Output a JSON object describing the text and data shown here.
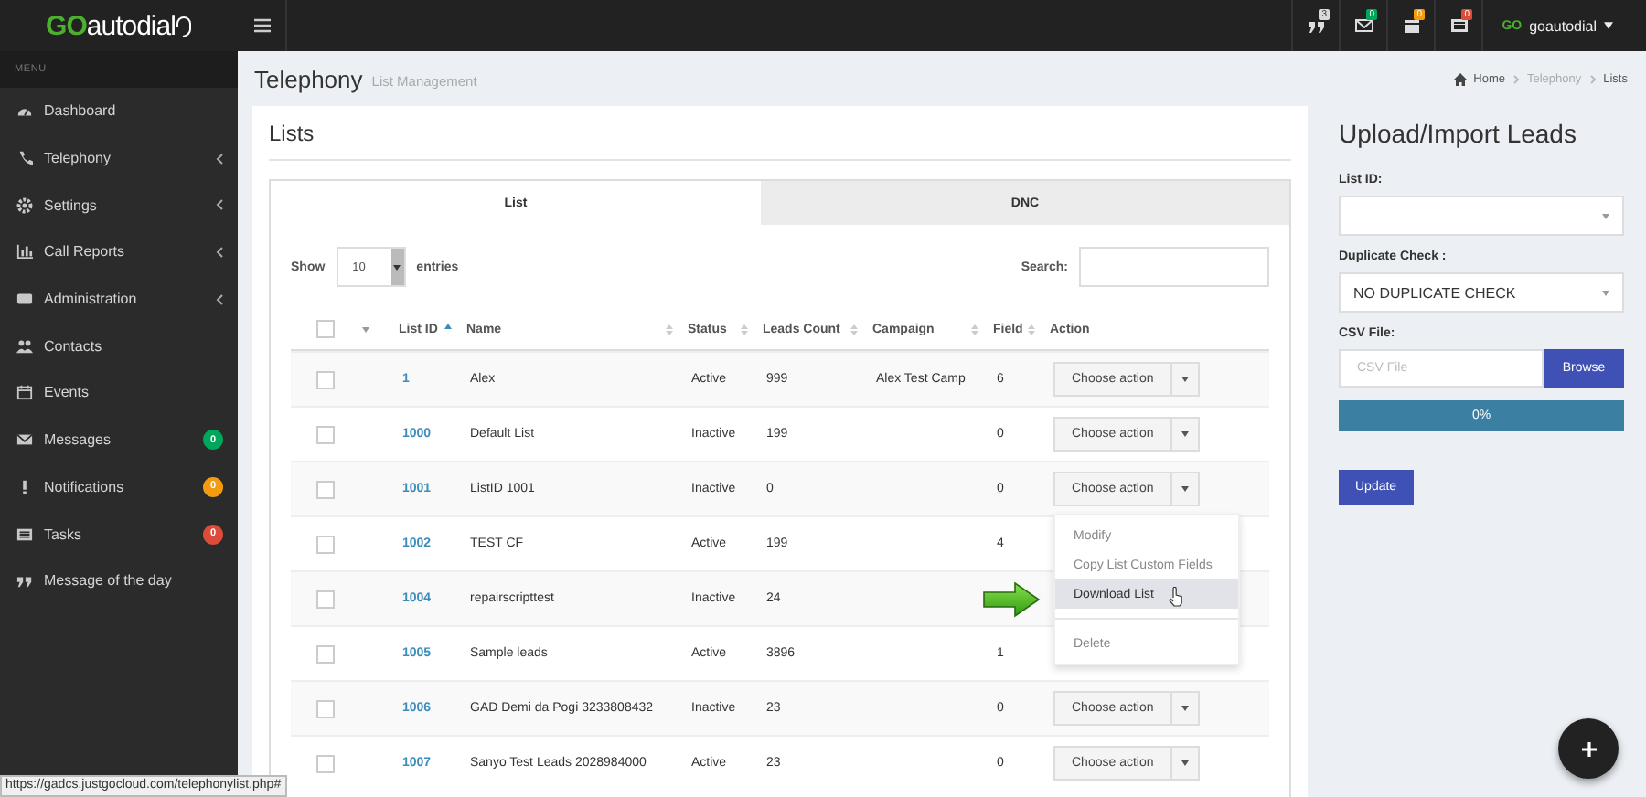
{
  "topbar": {
    "logo": {
      "prefix": "GO",
      "name": "autodial"
    },
    "notifications": [
      {
        "count": "3",
        "color": "#d9d9d9"
      },
      {
        "count": "0",
        "color": "#00a65a"
      },
      {
        "count": "0",
        "color": "#f39c12"
      },
      {
        "count": "0",
        "color": "#dd4b39"
      }
    ],
    "user": {
      "avatar_text": "GO",
      "name": "goautodial"
    }
  },
  "sidebar": {
    "header": "MENU",
    "items": [
      {
        "label": "Dashboard",
        "expandable": false
      },
      {
        "label": "Telephony",
        "expandable": true
      },
      {
        "label": "Settings",
        "expandable": true
      },
      {
        "label": "Call Reports",
        "expandable": true
      },
      {
        "label": "Administration",
        "expandable": true
      },
      {
        "label": "Contacts",
        "expandable": false
      },
      {
        "label": "Events",
        "expandable": false
      },
      {
        "label": "Messages",
        "expandable": false,
        "badge": "0",
        "color": "#00a65a"
      },
      {
        "label": "Notifications",
        "expandable": false,
        "badge": "0",
        "color": "#f39c12"
      },
      {
        "label": "Tasks",
        "expandable": false,
        "badge": "0",
        "color": "#dd4b39"
      },
      {
        "label": "Message of the day",
        "expandable": false
      }
    ]
  },
  "page": {
    "title": "Telephony",
    "subtitle": "List Management",
    "breadcrumb": [
      "Home",
      "Telephony",
      "Lists"
    ]
  },
  "lists_card": {
    "title": "Lists",
    "tabs": [
      {
        "label": "List",
        "selected": true
      },
      {
        "label": "DNC",
        "selected": false
      }
    ],
    "length": {
      "label_before": "Show",
      "value": "10",
      "label_after": "entries"
    },
    "search": {
      "label": "Search:"
    },
    "select_all": {
      "checked": false
    },
    "columns": [
      {
        "label": "List ID",
        "sortable": true,
        "sorted": true
      },
      {
        "label": "Name",
        "sortable": true,
        "sorted": false
      },
      {
        "label": "Status",
        "sortable": true,
        "sorted": false
      },
      {
        "label": "Leads Count",
        "sortable": true,
        "sorted": false
      },
      {
        "label": "Campaign",
        "sortable": true,
        "sorted": false
      },
      {
        "label": "Field",
        "sortable": true,
        "sorted": false
      },
      {
        "label": "Action",
        "sortable": false
      }
    ],
    "rows": [
      {
        "checked": false,
        "list_id": "1",
        "name": "Alex",
        "status": "Active",
        "leads_count": "999",
        "campaign": "Alex Test Camp",
        "field": "6",
        "action": "Choose action"
      },
      {
        "checked": false,
        "list_id": "1000",
        "name": "Default List",
        "status": "Inactive",
        "leads_count": "199",
        "field": "0",
        "action": "Choose action"
      },
      {
        "checked": false,
        "list_id": "1001",
        "name": "ListID 1001",
        "status": "Inactive",
        "leads_count": "0",
        "field": "0",
        "action": "Choose action",
        "menu": [
          {
            "label": "Modify",
            "selected": false
          },
          {
            "label": "Copy List Custom Fields",
            "selected": false
          },
          {
            "label": "Download List",
            "selected": true
          },
          {
            "label": "Delete",
            "selected": false,
            "divider_before": true
          }
        ]
      },
      {
        "checked": false,
        "list_id": "1002",
        "name": "TEST CF",
        "status": "Active",
        "leads_count": "199",
        "field": "4"
      },
      {
        "checked": false,
        "list_id": "1004",
        "name": "repairscripttest",
        "status": "Inactive",
        "leads_count": "24",
        "pointer_arrow": true
      },
      {
        "checked": false,
        "list_id": "1005",
        "name": "Sample leads",
        "status": "Active",
        "leads_count": "3896",
        "field": "1"
      },
      {
        "checked": false,
        "list_id": "1006",
        "name": "GAD Demi da Pogi 3233808432",
        "status": "Inactive",
        "leads_count": "23",
        "field": "0",
        "action": "Choose action"
      },
      {
        "checked": false,
        "list_id": "1007",
        "name": "Sanyo Test Leads 2028984000",
        "status": "Active",
        "leads_count": "23",
        "field": "0",
        "action": "Choose action"
      }
    ]
  },
  "upload": {
    "title": "Upload/Import Leads",
    "list_id_label": "List ID:",
    "duplicate_label": "Duplicate Check :",
    "duplicate_value": "NO DUPLICATE CHECK",
    "csv_label": "CSV File:",
    "csv_placeholder": "CSV File",
    "browse": "Browse",
    "progress": {
      "level": 0,
      "reading": "0%"
    },
    "update": "Update"
  },
  "status_bar": "https://gadcs.justgocloud.com/telephonylist.php#"
}
